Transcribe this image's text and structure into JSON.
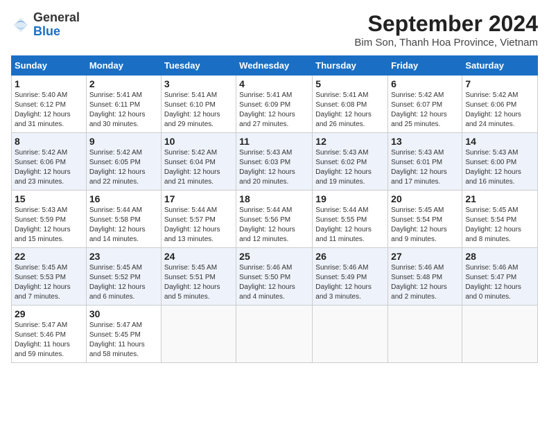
{
  "header": {
    "logo_general": "General",
    "logo_blue": "Blue",
    "title": "September 2024",
    "subtitle": "Bim Son, Thanh Hoa Province, Vietnam"
  },
  "calendar": {
    "columns": [
      "Sunday",
      "Monday",
      "Tuesday",
      "Wednesday",
      "Thursday",
      "Friday",
      "Saturday"
    ],
    "weeks": [
      [
        {
          "day": "",
          "info": ""
        },
        {
          "day": "2",
          "info": "Sunrise: 5:41 AM\nSunset: 6:11 PM\nDaylight: 12 hours\nand 30 minutes."
        },
        {
          "day": "3",
          "info": "Sunrise: 5:41 AM\nSunset: 6:10 PM\nDaylight: 12 hours\nand 29 minutes."
        },
        {
          "day": "4",
          "info": "Sunrise: 5:41 AM\nSunset: 6:09 PM\nDaylight: 12 hours\nand 27 minutes."
        },
        {
          "day": "5",
          "info": "Sunrise: 5:41 AM\nSunset: 6:08 PM\nDaylight: 12 hours\nand 26 minutes."
        },
        {
          "day": "6",
          "info": "Sunrise: 5:42 AM\nSunset: 6:07 PM\nDaylight: 12 hours\nand 25 minutes."
        },
        {
          "day": "7",
          "info": "Sunrise: 5:42 AM\nSunset: 6:06 PM\nDaylight: 12 hours\nand 24 minutes."
        }
      ],
      [
        {
          "day": "1",
          "info": "Sunrise: 5:40 AM\nSunset: 6:12 PM\nDaylight: 12 hours\nand 31 minutes."
        },
        {
          "day": "",
          "info": ""
        },
        {
          "day": "",
          "info": ""
        },
        {
          "day": "",
          "info": ""
        },
        {
          "day": "",
          "info": ""
        },
        {
          "day": "",
          "info": ""
        },
        {
          "day": "",
          "info": ""
        }
      ],
      [
        {
          "day": "8",
          "info": "Sunrise: 5:42 AM\nSunset: 6:06 PM\nDaylight: 12 hours\nand 23 minutes."
        },
        {
          "day": "9",
          "info": "Sunrise: 5:42 AM\nSunset: 6:05 PM\nDaylight: 12 hours\nand 22 minutes."
        },
        {
          "day": "10",
          "info": "Sunrise: 5:42 AM\nSunset: 6:04 PM\nDaylight: 12 hours\nand 21 minutes."
        },
        {
          "day": "11",
          "info": "Sunrise: 5:43 AM\nSunset: 6:03 PM\nDaylight: 12 hours\nand 20 minutes."
        },
        {
          "day": "12",
          "info": "Sunrise: 5:43 AM\nSunset: 6:02 PM\nDaylight: 12 hours\nand 19 minutes."
        },
        {
          "day": "13",
          "info": "Sunrise: 5:43 AM\nSunset: 6:01 PM\nDaylight: 12 hours\nand 17 minutes."
        },
        {
          "day": "14",
          "info": "Sunrise: 5:43 AM\nSunset: 6:00 PM\nDaylight: 12 hours\nand 16 minutes."
        }
      ],
      [
        {
          "day": "15",
          "info": "Sunrise: 5:43 AM\nSunset: 5:59 PM\nDaylight: 12 hours\nand 15 minutes."
        },
        {
          "day": "16",
          "info": "Sunrise: 5:44 AM\nSunset: 5:58 PM\nDaylight: 12 hours\nand 14 minutes."
        },
        {
          "day": "17",
          "info": "Sunrise: 5:44 AM\nSunset: 5:57 PM\nDaylight: 12 hours\nand 13 minutes."
        },
        {
          "day": "18",
          "info": "Sunrise: 5:44 AM\nSunset: 5:56 PM\nDaylight: 12 hours\nand 12 minutes."
        },
        {
          "day": "19",
          "info": "Sunrise: 5:44 AM\nSunset: 5:55 PM\nDaylight: 12 hours\nand 11 minutes."
        },
        {
          "day": "20",
          "info": "Sunrise: 5:45 AM\nSunset: 5:54 PM\nDaylight: 12 hours\nand 9 minutes."
        },
        {
          "day": "21",
          "info": "Sunrise: 5:45 AM\nSunset: 5:54 PM\nDaylight: 12 hours\nand 8 minutes."
        }
      ],
      [
        {
          "day": "22",
          "info": "Sunrise: 5:45 AM\nSunset: 5:53 PM\nDaylight: 12 hours\nand 7 minutes."
        },
        {
          "day": "23",
          "info": "Sunrise: 5:45 AM\nSunset: 5:52 PM\nDaylight: 12 hours\nand 6 minutes."
        },
        {
          "day": "24",
          "info": "Sunrise: 5:45 AM\nSunset: 5:51 PM\nDaylight: 12 hours\nand 5 minutes."
        },
        {
          "day": "25",
          "info": "Sunrise: 5:46 AM\nSunset: 5:50 PM\nDaylight: 12 hours\nand 4 minutes."
        },
        {
          "day": "26",
          "info": "Sunrise: 5:46 AM\nSunset: 5:49 PM\nDaylight: 12 hours\nand 3 minutes."
        },
        {
          "day": "27",
          "info": "Sunrise: 5:46 AM\nSunset: 5:48 PM\nDaylight: 12 hours\nand 2 minutes."
        },
        {
          "day": "28",
          "info": "Sunrise: 5:46 AM\nSunset: 5:47 PM\nDaylight: 12 hours\nand 0 minutes."
        }
      ],
      [
        {
          "day": "29",
          "info": "Sunrise: 5:47 AM\nSunset: 5:46 PM\nDaylight: 11 hours\nand 59 minutes."
        },
        {
          "day": "30",
          "info": "Sunrise: 5:47 AM\nSunset: 5:45 PM\nDaylight: 11 hours\nand 58 minutes."
        },
        {
          "day": "",
          "info": ""
        },
        {
          "day": "",
          "info": ""
        },
        {
          "day": "",
          "info": ""
        },
        {
          "day": "",
          "info": ""
        },
        {
          "day": "",
          "info": ""
        }
      ]
    ]
  }
}
